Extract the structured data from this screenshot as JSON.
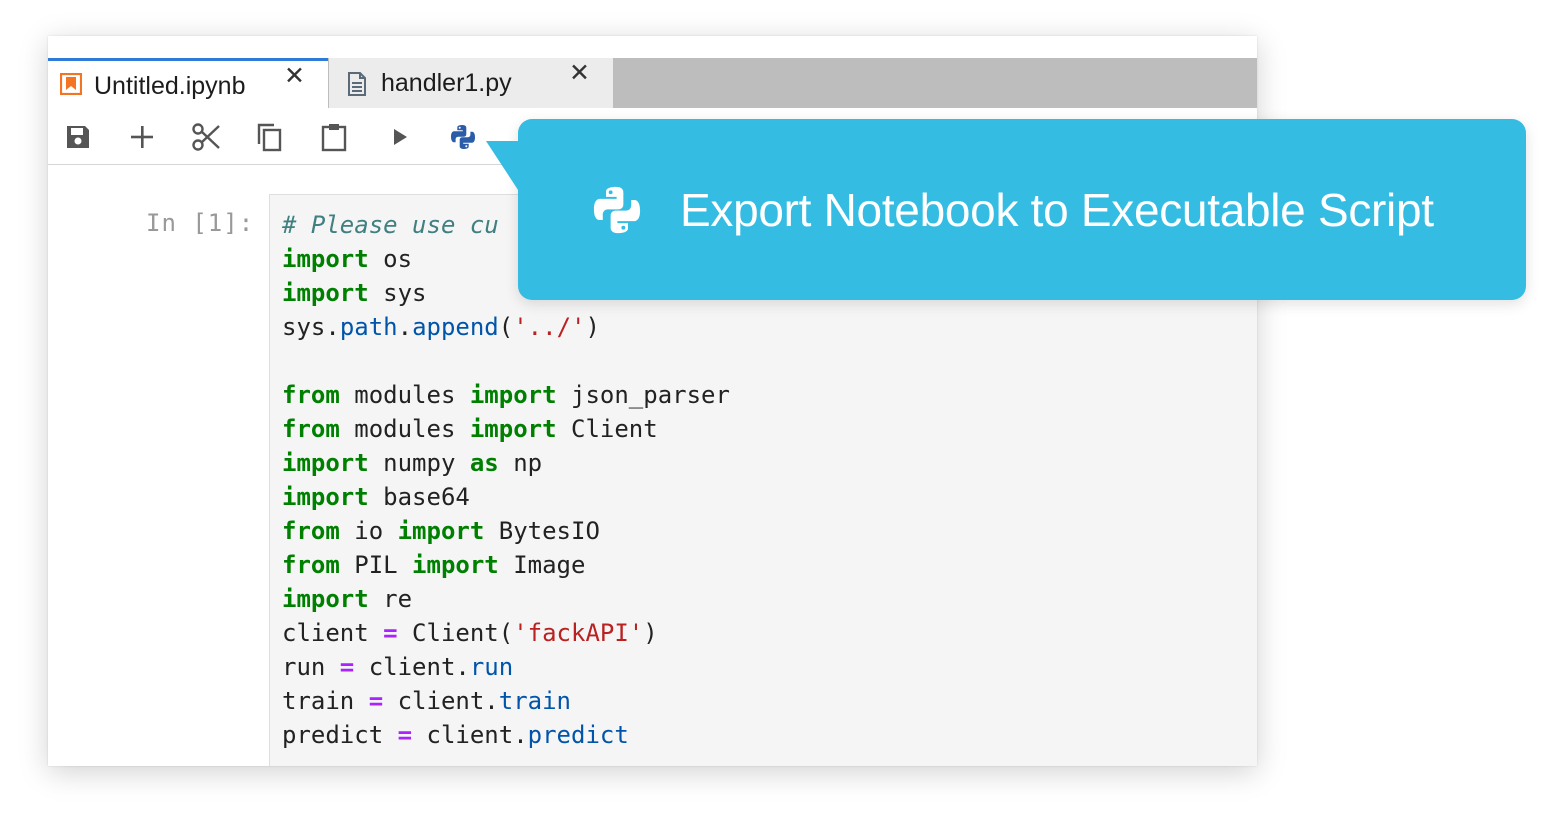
{
  "tabs": [
    {
      "label": "Untitled.ipynb",
      "icon": "notebook-icon",
      "close": "✕",
      "active": true
    },
    {
      "label": "handler1.py",
      "icon": "file-icon",
      "close": "✕",
      "active": false
    }
  ],
  "toolbar": {
    "buttons": [
      "save-icon",
      "add-cell-icon",
      "cut-icon",
      "copy-icon",
      "paste-icon",
      "run-icon",
      "python-export-icon"
    ]
  },
  "cell": {
    "prompt": "In [1]:",
    "lines": [
      [
        {
          "t": "# Please use cu",
          "c": "com"
        }
      ],
      [
        {
          "t": "import",
          "c": "kw"
        },
        {
          "t": " os",
          "c": ""
        }
      ],
      [
        {
          "t": "import",
          "c": "kw"
        },
        {
          "t": " sys",
          "c": ""
        }
      ],
      [
        {
          "t": "sys",
          "c": ""
        },
        {
          "t": ".",
          "c": ""
        },
        {
          "t": "path",
          "c": "attr"
        },
        {
          "t": ".",
          "c": ""
        },
        {
          "t": "append",
          "c": "attr"
        },
        {
          "t": "(",
          "c": ""
        },
        {
          "t": "'../'",
          "c": "str"
        },
        {
          "t": ")",
          "c": ""
        }
      ],
      [
        {
          "t": "",
          "c": ""
        }
      ],
      [
        {
          "t": "from",
          "c": "kw"
        },
        {
          "t": " modules ",
          "c": ""
        },
        {
          "t": "import",
          "c": "kw"
        },
        {
          "t": " json_parser",
          "c": ""
        }
      ],
      [
        {
          "t": "from",
          "c": "kw"
        },
        {
          "t": " modules ",
          "c": ""
        },
        {
          "t": "import",
          "c": "kw"
        },
        {
          "t": " Client",
          "c": ""
        }
      ],
      [
        {
          "t": "import",
          "c": "kw"
        },
        {
          "t": " numpy ",
          "c": ""
        },
        {
          "t": "as",
          "c": "kw"
        },
        {
          "t": " np",
          "c": ""
        }
      ],
      [
        {
          "t": "import",
          "c": "kw"
        },
        {
          "t": " base64",
          "c": ""
        }
      ],
      [
        {
          "t": "from",
          "c": "kw"
        },
        {
          "t": " io ",
          "c": ""
        },
        {
          "t": "import",
          "c": "kw"
        },
        {
          "t": " BytesIO",
          "c": ""
        }
      ],
      [
        {
          "t": "from",
          "c": "kw"
        },
        {
          "t": " PIL ",
          "c": ""
        },
        {
          "t": "import",
          "c": "kw"
        },
        {
          "t": " Image",
          "c": ""
        }
      ],
      [
        {
          "t": "import",
          "c": "kw"
        },
        {
          "t": " re",
          "c": ""
        }
      ],
      [
        {
          "t": "client ",
          "c": ""
        },
        {
          "t": "=",
          "c": "op"
        },
        {
          "t": " Client(",
          "c": ""
        },
        {
          "t": "'fackAPI'",
          "c": "str"
        },
        {
          "t": ")",
          "c": ""
        }
      ],
      [
        {
          "t": "run ",
          "c": ""
        },
        {
          "t": "=",
          "c": "op"
        },
        {
          "t": " client.",
          "c": ""
        },
        {
          "t": "run",
          "c": "attr"
        }
      ],
      [
        {
          "t": "train ",
          "c": ""
        },
        {
          "t": "=",
          "c": "op"
        },
        {
          "t": " client.",
          "c": ""
        },
        {
          "t": "train",
          "c": "attr"
        }
      ],
      [
        {
          "t": "predict ",
          "c": ""
        },
        {
          "t": "=",
          "c": "op"
        },
        {
          "t": " client.",
          "c": ""
        },
        {
          "t": "predict",
          "c": "attr"
        }
      ]
    ]
  },
  "tooltip": {
    "text": "Export Notebook to Executable Script",
    "icon": "python-icon",
    "color": "#35bce2"
  },
  "colors": {
    "tab_accent": "#2d7bd6",
    "notebook_icon": "#f37524",
    "keyword": "#008000",
    "operator": "#aa22ff",
    "string": "#ba2121",
    "attribute": "#0055aa",
    "comment": "#408080",
    "python_blue": "#2a5ca8"
  }
}
